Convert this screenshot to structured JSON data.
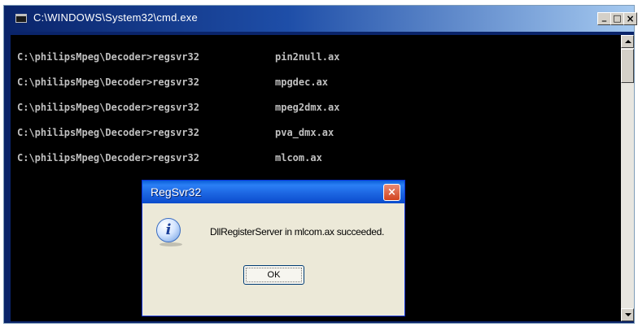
{
  "window": {
    "title": "C:\\WINDOWS\\System32\\cmd.exe",
    "controls": {
      "minimize": "_",
      "maximize": "□",
      "close": "×"
    }
  },
  "console": {
    "lines": [
      {
        "prompt": "C:\\philipsMpeg\\Decoder>regsvr32",
        "arg": "pin2null.ax"
      },
      {
        "prompt": "C:\\philipsMpeg\\Decoder>regsvr32",
        "arg": "mpgdec.ax"
      },
      {
        "prompt": "C:\\philipsMpeg\\Decoder>regsvr32",
        "arg": "mpeg2dmx.ax"
      },
      {
        "prompt": "C:\\philipsMpeg\\Decoder>regsvr32",
        "arg": "pva_dmx.ax"
      },
      {
        "prompt": "C:\\philipsMpeg\\Decoder>regsvr32",
        "arg": "mlcom.ax"
      }
    ]
  },
  "dialog": {
    "title": "RegSvr32",
    "close_glyph": "×",
    "icon": "information-icon",
    "icon_glyph": "i",
    "message": "DllRegisterServer in mlcom.ax succeeded.",
    "ok_label": "OK"
  },
  "colors": {
    "console_bg": "#000000",
    "console_text": "#c0c0c0",
    "cmd_titlebar": "#0a246a",
    "dialog_titlebar": "#1b63e0",
    "dialog_close": "#d2441f"
  }
}
